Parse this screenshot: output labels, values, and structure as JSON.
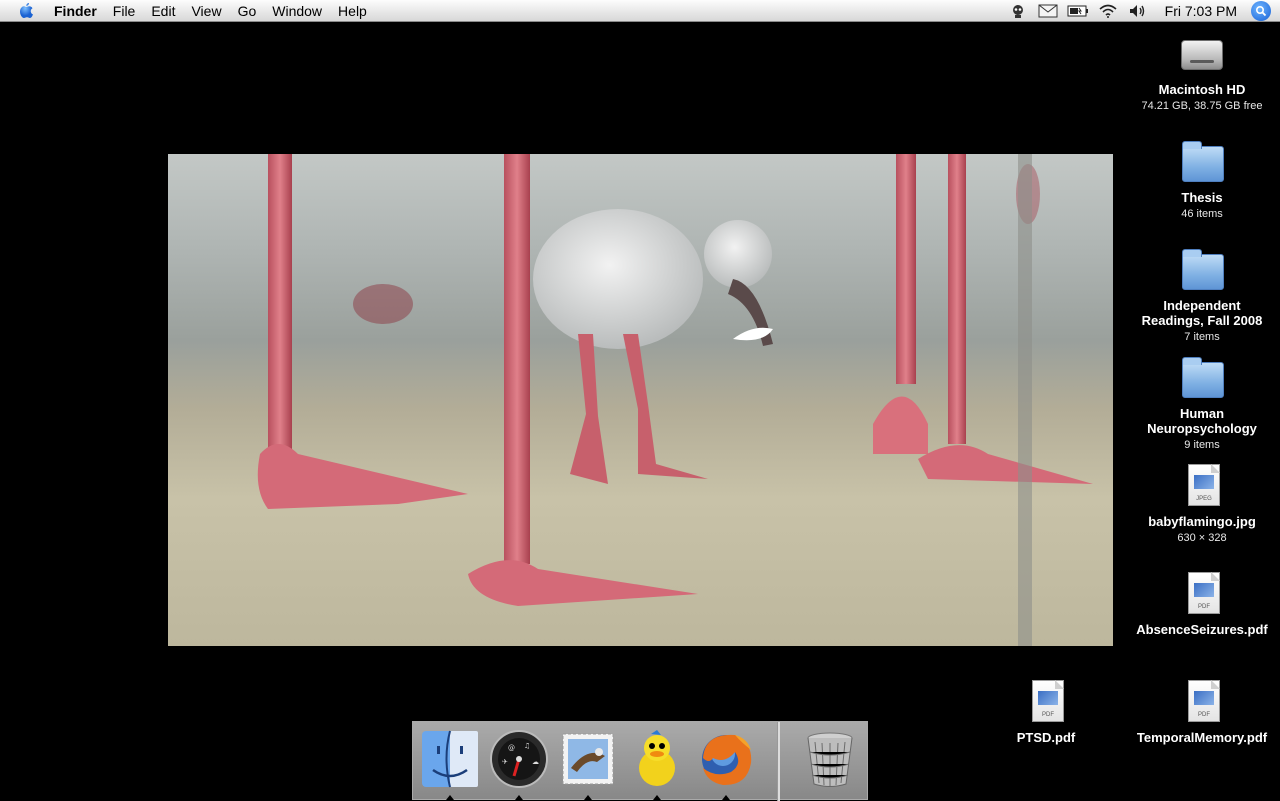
{
  "menubar": {
    "app_name": "Finder",
    "menus": [
      "File",
      "Edit",
      "View",
      "Go",
      "Window",
      "Help"
    ],
    "clock": "Fri 7:03 PM",
    "status_icons": [
      "robot-icon",
      "mail-icon",
      "battery-icon",
      "wifi-icon",
      "volume-icon"
    ]
  },
  "desktop": {
    "icons": [
      {
        "name": "Macintosh HD",
        "info": "74.21 GB, 38.75 GB free",
        "kind": "hard-drive"
      },
      {
        "name": "Thesis",
        "info": "46 items",
        "kind": "folder"
      },
      {
        "name": "Independent Readings, Fall 2008",
        "info": "7 items",
        "kind": "folder"
      },
      {
        "name": "Human Neuropsychology",
        "info": "9 items",
        "kind": "folder"
      },
      {
        "name": "babyflamingo.jpg",
        "info": "630 × 328",
        "kind": "jpeg",
        "tag": "JPEG"
      },
      {
        "name": "AbsenceSeizures.pdf",
        "info": "",
        "kind": "pdf",
        "tag": "PDF"
      },
      {
        "name": "PTSD.pdf",
        "info": "",
        "kind": "pdf",
        "tag": "PDF"
      },
      {
        "name": "TemporalMemory.pdf",
        "info": "",
        "kind": "pdf",
        "tag": "PDF"
      }
    ]
  },
  "dock": {
    "apps": [
      "Finder",
      "Dashboard",
      "Mail",
      "Adium",
      "Firefox"
    ],
    "trash": "Trash"
  },
  "colors": {
    "desktop_bg": "#000000",
    "menubar_bg": "#ececec",
    "spotlight": "#1f6fe0",
    "folder_blue": "#7fb0e3"
  }
}
